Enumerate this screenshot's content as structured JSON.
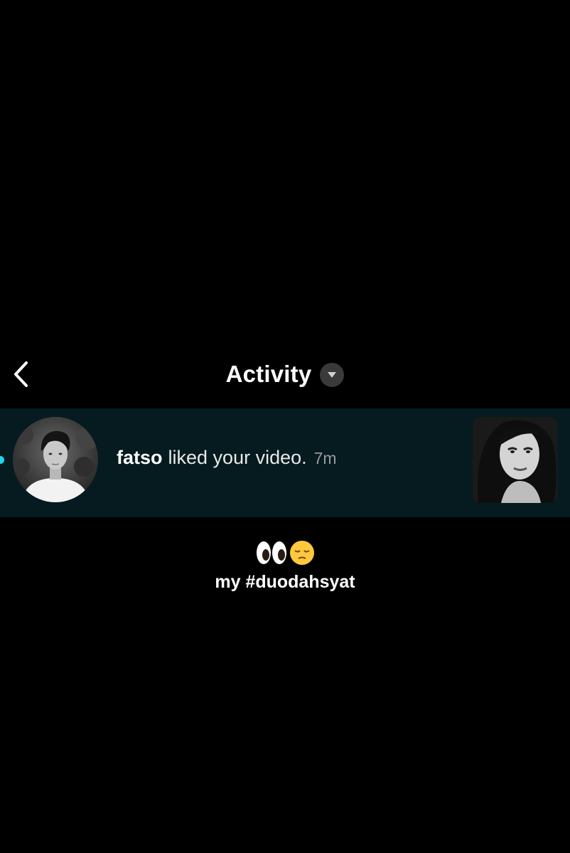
{
  "header": {
    "title": "Activity",
    "back_icon": "chevron-left-icon",
    "dropdown_icon": "caret-down-icon"
  },
  "notification": {
    "username": "fatso",
    "action": "liked your video.",
    "time": "7m",
    "unread": true,
    "highlight_color": "#051b1f",
    "unread_dot_color": "#20d5ec"
  },
  "caption": {
    "emojis": [
      "eyes-emoji",
      "pensive-face-emoji"
    ],
    "text": "my #duodahsyat"
  }
}
